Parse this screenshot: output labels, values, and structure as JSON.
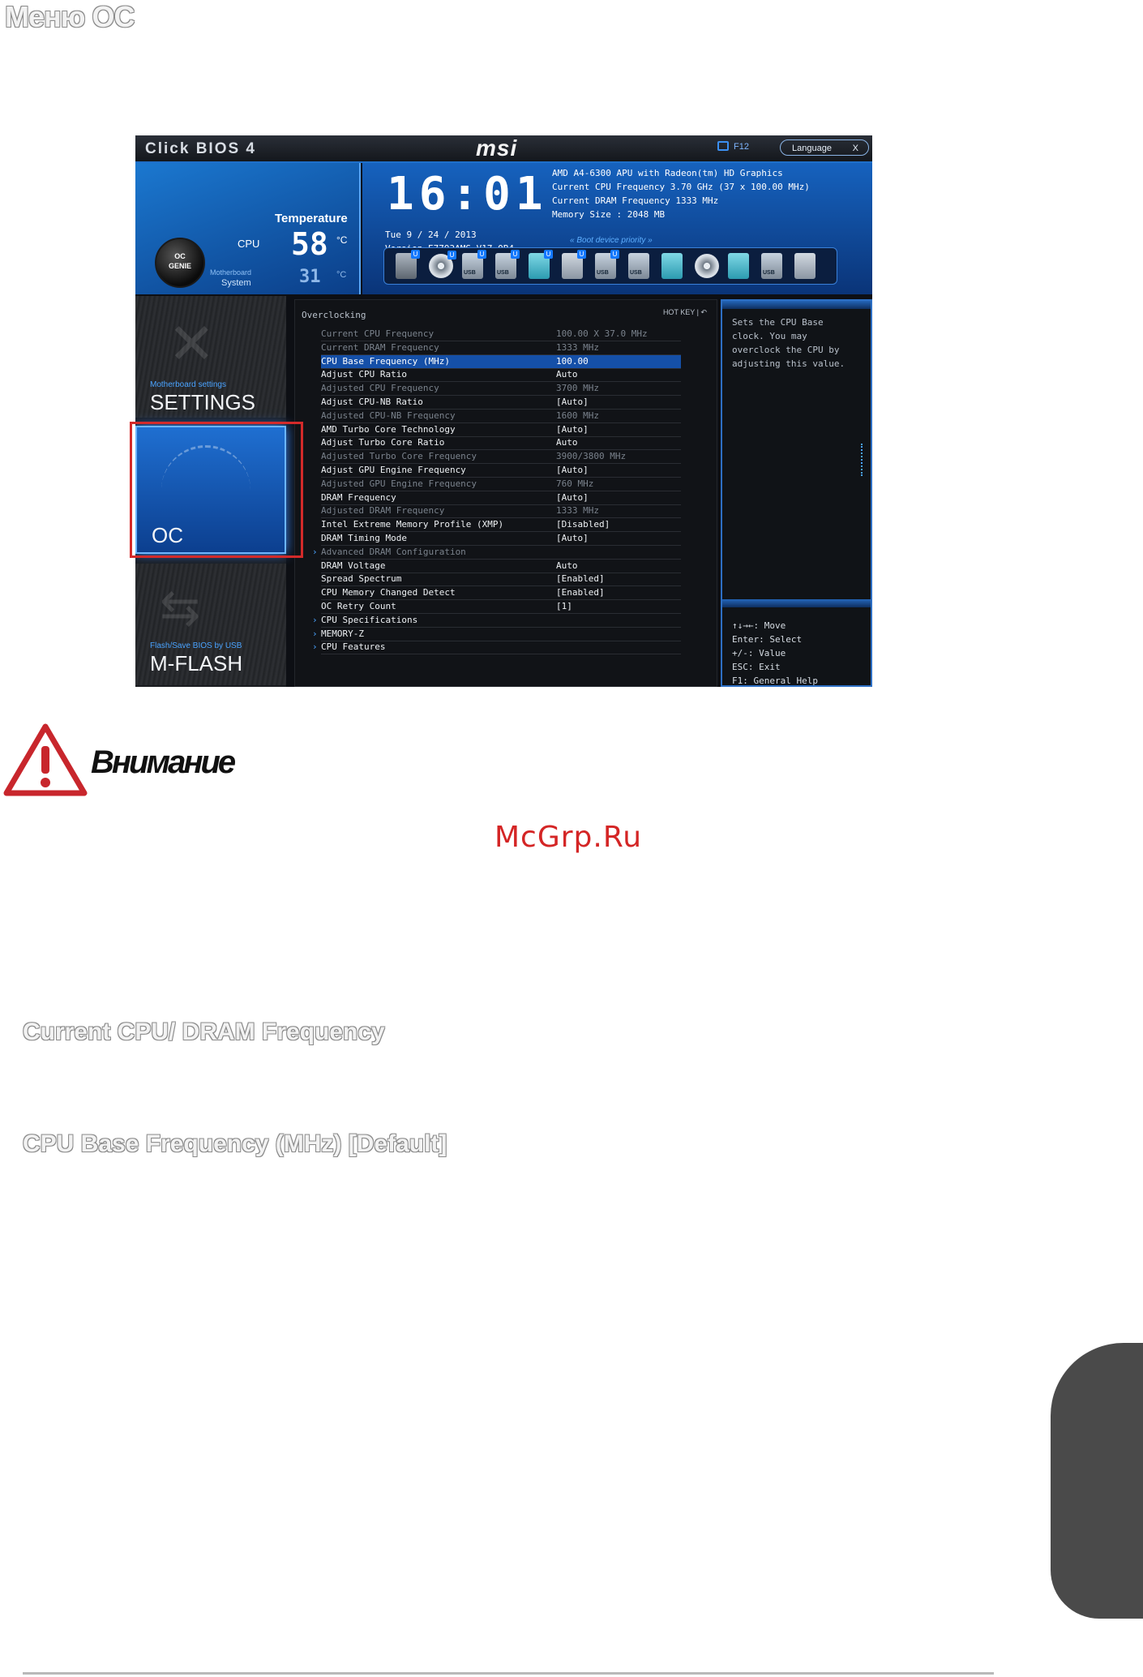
{
  "page": {
    "title": "Меню OC",
    "warning_label": "Внимание",
    "watermark": "McGrp.Ru",
    "sections": [
      "Current CPU/ DRAM Frequency",
      "CPU Base Frequency (MHz) [Default]"
    ]
  },
  "bios": {
    "brand": "Click BIOS 4",
    "logo": "msi",
    "f12_label": "F12",
    "language_button": "Language",
    "language_close": "X",
    "clock": "16:01",
    "oc_genie": {
      "line1": "OC",
      "line2": "GENIE"
    },
    "temperature": {
      "title": "Temperature",
      "cpu_label": "CPU",
      "cpu_value": "58",
      "cpu_unit": "°C",
      "motherboard_label": "Motherboard",
      "system_label": "System",
      "system_value": "31",
      "system_unit": "°C"
    },
    "date_line": "Tue  9 / 24 / 2013",
    "version_line": "Version E7793AMS V17.0B4",
    "sysinfo": [
      "AMD A4-6300 APU with Radeon(tm) HD Graphics",
      "Current CPU Frequency 3.70 GHz (37 x 100.00 MHz)",
      "Current DRAM Frequency 1333 MHz",
      "Memory Size : 2048 MB"
    ],
    "boot_priority_label": "Boot device priority",
    "boot_devices": [
      {
        "kind": "hdd",
        "badge": "U",
        "icon": "hard-drive-icon"
      },
      {
        "kind": "cd",
        "badge": "U",
        "icon": "optical-disc-icon"
      },
      {
        "kind": "usb",
        "badge": "U",
        "label": "USB",
        "icon": "usb-drive-icon"
      },
      {
        "kind": "usb",
        "badge": "U",
        "label": "USB",
        "icon": "usb-drive-icon"
      },
      {
        "kind": "net",
        "badge": "U",
        "icon": "network-boot-icon"
      },
      {
        "kind": "card",
        "badge": "U",
        "icon": "memory-card-icon"
      },
      {
        "kind": "usb",
        "badge": "U",
        "label": "USB",
        "icon": "usb-drive-icon"
      },
      {
        "kind": "usb",
        "badge": "",
        "label": "USB",
        "icon": "usb-drive-icon"
      },
      {
        "kind": "net",
        "badge": "",
        "icon": "network-boot-icon"
      },
      {
        "kind": "cd",
        "badge": "",
        "icon": "optical-disc-icon"
      },
      {
        "kind": "net",
        "badge": "",
        "icon": "network-boot-icon"
      },
      {
        "kind": "usb",
        "badge": "",
        "label": "USB",
        "icon": "usb-drive-icon"
      },
      {
        "kind": "card",
        "badge": "",
        "icon": "memory-card-icon"
      }
    ],
    "sidebar": [
      {
        "sub": "Motherboard settings",
        "main": "SETTINGS",
        "icon": "tools-icon",
        "active": false
      },
      {
        "sub": "",
        "main": "OC",
        "icon": "gauge-icon",
        "active": true
      },
      {
        "sub": "Flash/Save BIOS by USB",
        "main": "M-FLASH",
        "icon": "usb-icon",
        "active": false
      }
    ],
    "panel": {
      "title": "Overclocking",
      "hotkey": "HOT KEY  |  ↶",
      "rows": [
        {
          "name": "Current CPU Frequency",
          "value": "100.00 X 37.0 MHz",
          "state": "dim"
        },
        {
          "name": "Current DRAM Frequency",
          "value": "1333 MHz",
          "state": "dim"
        },
        {
          "name": "CPU Base Frequency (MHz)",
          "value": "100.00",
          "state": "sel"
        },
        {
          "name": "Adjust CPU Ratio",
          "value": "Auto",
          "state": "on"
        },
        {
          "name": "Adjusted CPU Frequency",
          "value": "3700 MHz",
          "state": "dim"
        },
        {
          "name": "Adjust CPU-NB Ratio",
          "value": "[Auto]",
          "state": "on"
        },
        {
          "name": "Adjusted CPU-NB Frequency",
          "value": "1600 MHz",
          "state": "dim"
        },
        {
          "name": "AMD Turbo Core Technology",
          "value": "[Auto]",
          "state": "on"
        },
        {
          "name": "Adjust Turbo Core Ratio",
          "value": "Auto",
          "state": "on"
        },
        {
          "name": "Adjusted Turbo Core Frequency",
          "value": "3900/3800 MHz",
          "state": "dim"
        },
        {
          "name": "Adjust GPU Engine Frequency",
          "value": "[Auto]",
          "state": "on"
        },
        {
          "name": "Adjusted GPU Engine Frequency",
          "value": "760 MHz",
          "state": "dim"
        },
        {
          "name": "DRAM Frequency",
          "value": "[Auto]",
          "state": "on"
        },
        {
          "name": "Adjusted DRAM Frequency",
          "value": "1333 MHz",
          "state": "dim"
        },
        {
          "name": "Intel Extreme Memory Profile (XMP)",
          "value": "[Disabled]",
          "state": "on"
        },
        {
          "name": "DRAM Timing Mode",
          "value": "[Auto]",
          "state": "on"
        },
        {
          "name": "Advanced DRAM Configuration",
          "value": "",
          "state": "dim",
          "submenu": true
        },
        {
          "name": "DRAM Voltage",
          "value": "Auto",
          "state": "on"
        },
        {
          "name": "Spread Spectrum",
          "value": "[Enabled]",
          "state": "on"
        },
        {
          "name": "CPU Memory Changed Detect",
          "value": "[Enabled]",
          "state": "on"
        },
        {
          "name": "OC Retry Count",
          "value": "[1]",
          "state": "on"
        },
        {
          "name": "CPU Specifications",
          "value": "",
          "state": "on",
          "submenu": true
        },
        {
          "name": "MEMORY-Z",
          "value": "",
          "state": "on",
          "submenu": true
        },
        {
          "name": "CPU Features",
          "value": "",
          "state": "on",
          "submenu": true
        }
      ]
    },
    "help": {
      "text": "Sets the CPU Base clock. You may overclock the CPU by adjusting this value.",
      "keys": [
        "↑↓→←: Move",
        "Enter: Select",
        "+/-: Value",
        "ESC: Exit",
        "F1: General Help"
      ]
    }
  }
}
